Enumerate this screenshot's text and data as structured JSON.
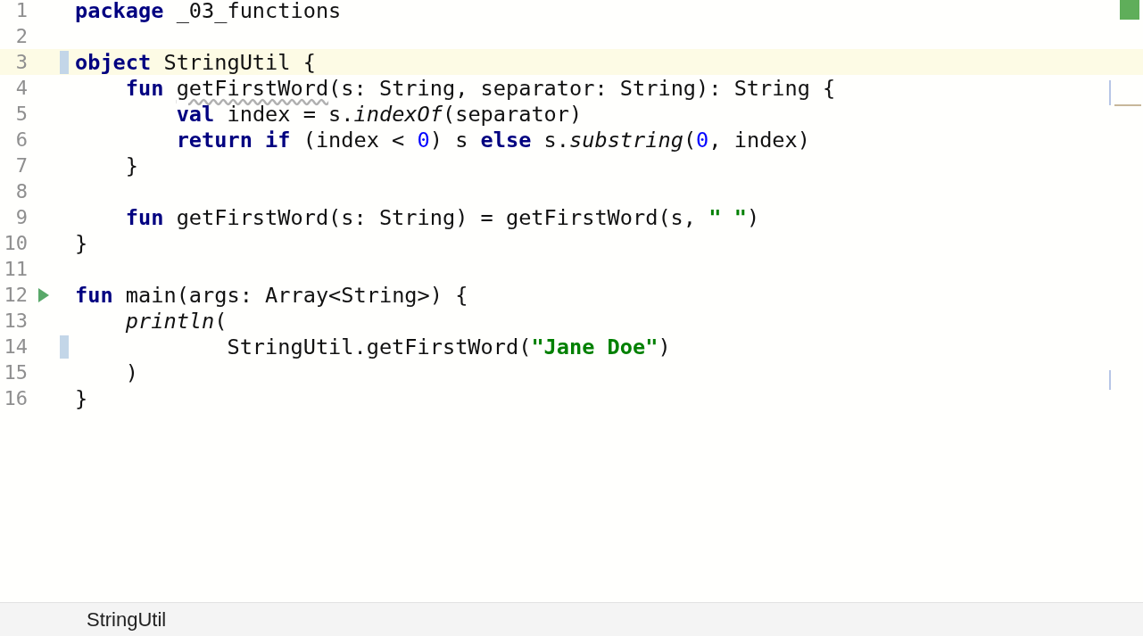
{
  "editor": {
    "lines": [
      {
        "number": "1",
        "tokens": [
          {
            "kind": "keyword",
            "text": "package"
          },
          {
            "kind": "plain",
            "text": " _03_functions"
          }
        ]
      },
      {
        "number": "2"
      },
      {
        "number": "3",
        "current": true,
        "changed": true,
        "tokens": [
          {
            "kind": "keyword",
            "text": "object"
          },
          {
            "kind": "plain",
            "text": " StringUtil {"
          }
        ]
      },
      {
        "number": "4",
        "tokens": [
          {
            "kind": "keyword",
            "text": "    fun "
          },
          {
            "kind": "warning",
            "text": "getFirstWord"
          },
          {
            "kind": "plain",
            "text": "(s: String, separator: String): String {"
          }
        ]
      },
      {
        "number": "5",
        "tokens": [
          {
            "kind": "keyword",
            "text": "        val"
          },
          {
            "kind": "plain",
            "text": " index = s."
          },
          {
            "kind": "call",
            "text": "indexOf"
          },
          {
            "kind": "plain",
            "text": "(separator)"
          }
        ]
      },
      {
        "number": "6",
        "tokens": [
          {
            "kind": "keyword",
            "text": "        return if"
          },
          {
            "kind": "plain",
            "text": " (index < "
          },
          {
            "kind": "number",
            "text": "0"
          },
          {
            "kind": "plain",
            "text": ") s "
          },
          {
            "kind": "keyword",
            "text": "else"
          },
          {
            "kind": "plain",
            "text": " s."
          },
          {
            "kind": "call",
            "text": "substring"
          },
          {
            "kind": "plain",
            "text": "("
          },
          {
            "kind": "number",
            "text": "0"
          },
          {
            "kind": "plain",
            "text": ", index)"
          }
        ]
      },
      {
        "number": "7",
        "tokens": [
          {
            "kind": "plain",
            "text": "    }"
          }
        ]
      },
      {
        "number": "8"
      },
      {
        "number": "9",
        "tokens": [
          {
            "kind": "keyword",
            "text": "    fun"
          },
          {
            "kind": "plain",
            "text": " getFirstWord(s: String) = getFirstWord(s, "
          },
          {
            "kind": "string",
            "text": "\" \""
          },
          {
            "kind": "plain",
            "text": ")"
          }
        ]
      },
      {
        "number": "10",
        "tokens": [
          {
            "kind": "plain",
            "text": "}"
          }
        ]
      },
      {
        "number": "11"
      },
      {
        "number": "12",
        "runnable": true,
        "tokens": [
          {
            "kind": "keyword",
            "text": "fun"
          },
          {
            "kind": "plain",
            "text": " main(args: Array<String>) {"
          }
        ]
      },
      {
        "number": "13",
        "tokens": [
          {
            "kind": "call",
            "text": "    println"
          },
          {
            "kind": "plain",
            "text": "("
          }
        ]
      },
      {
        "number": "14",
        "changed": true,
        "tokens": [
          {
            "kind": "plain",
            "text": "            StringUtil.getFirstWord("
          },
          {
            "kind": "string",
            "text": "\"Jane Doe\""
          },
          {
            "kind": "plain",
            "text": ")"
          }
        ]
      },
      {
        "number": "15",
        "tokens": [
          {
            "kind": "plain",
            "text": "    )"
          }
        ]
      },
      {
        "number": "16",
        "tokens": [
          {
            "kind": "plain",
            "text": "}"
          }
        ]
      }
    ]
  },
  "status_bar": {
    "breadcrumb": "StringUtil"
  }
}
